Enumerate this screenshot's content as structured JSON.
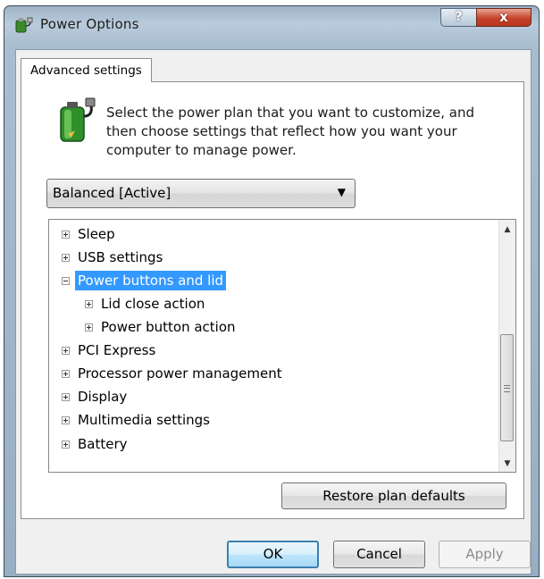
{
  "window": {
    "title": "Power Options",
    "help_glyph": "?",
    "close_glyph": "x"
  },
  "tab": {
    "label": "Advanced settings"
  },
  "description": "Select the power plan that you want to customize, and then choose settings that reflect how you want your computer to manage power.",
  "plan_select": {
    "value": "Balanced [Active]",
    "arrow": "▼"
  },
  "settings_tree": {
    "items": [
      {
        "label": "Sleep",
        "state": "collapsed",
        "level": 0
      },
      {
        "label": "USB settings",
        "state": "collapsed",
        "level": 0
      },
      {
        "label": "Power buttons and lid",
        "state": "expanded",
        "level": 0,
        "selected": true
      },
      {
        "label": "Lid close action",
        "state": "collapsed",
        "level": 1
      },
      {
        "label": "Power button action",
        "state": "collapsed",
        "level": 1
      },
      {
        "label": "PCI Express",
        "state": "collapsed",
        "level": 0
      },
      {
        "label": "Processor power management",
        "state": "collapsed",
        "level": 0
      },
      {
        "label": "Display",
        "state": "collapsed",
        "level": 0
      },
      {
        "label": "Multimedia settings",
        "state": "collapsed",
        "level": 0
      },
      {
        "label": "Battery",
        "state": "collapsed",
        "level": 0
      }
    ],
    "scroll_up_arrow": "▲",
    "scroll_down_arrow": "▼"
  },
  "buttons": {
    "restore": "Restore plan defaults",
    "ok": "OK",
    "cancel": "Cancel",
    "apply": "Apply"
  },
  "colors": {
    "selection": "#3399ff",
    "window_frame": "#a9bdd0",
    "close_button": "#c6432b"
  },
  "icons": {
    "title": "power-options-icon",
    "plan": "battery-plug-icon",
    "help": "help-icon",
    "close": "close-icon"
  }
}
